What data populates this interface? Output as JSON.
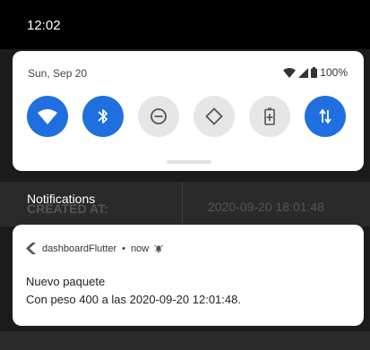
{
  "status_bar": {
    "time": "12:02"
  },
  "quick_settings": {
    "date": "Sun, Sep 20",
    "battery_text": "100%",
    "tiles": [
      {
        "name": "wifi",
        "state": "on"
      },
      {
        "name": "bluetooth",
        "state": "on"
      },
      {
        "name": "do-not-disturb",
        "state": "off"
      },
      {
        "name": "auto-rotate",
        "state": "off"
      },
      {
        "name": "battery-saver",
        "state": "off"
      },
      {
        "name": "mobile-data",
        "state": "on"
      }
    ],
    "colors": {
      "tile_on": "#1f6fe0",
      "tile_off": "#e6e6e6"
    }
  },
  "background_app": {
    "header": "CREATED AT:",
    "value": "2020-09-20 18:01:48"
  },
  "notifications": {
    "header": "Notifications",
    "items": [
      {
        "app": "dashboardFlutter",
        "separator": "•",
        "time": "now",
        "title": "Nuevo paquete",
        "body": "Con peso 400 a las 2020-09-20 12:01:48."
      }
    ]
  }
}
